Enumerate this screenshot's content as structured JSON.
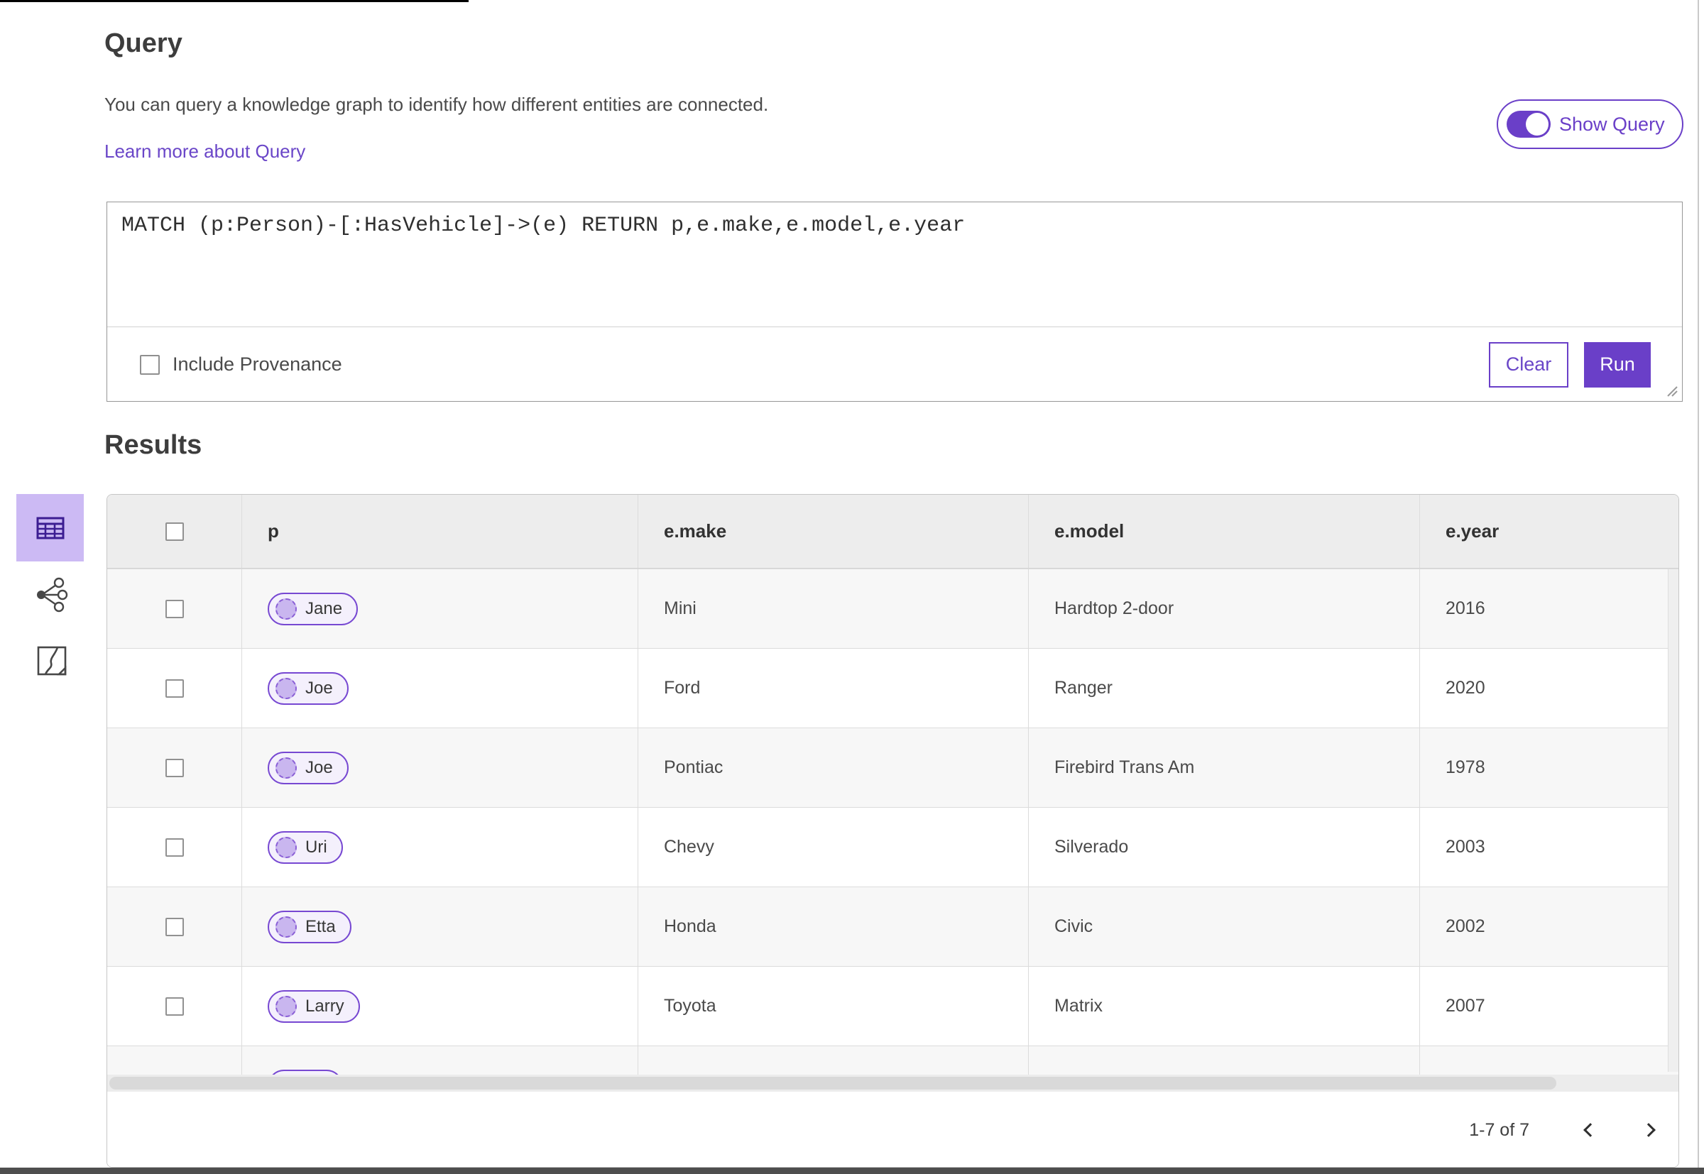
{
  "header": {
    "title": "Query",
    "description": "You can query a knowledge graph to identify how different entities are connected.",
    "learn_more_link": "Learn more about Query",
    "show_query_label": "Show Query",
    "show_query_toggle_state": "on"
  },
  "query_editor": {
    "text": "MATCH (p:Person)-[:HasVehicle]->(e) RETURN p,e.make,e.model,e.year",
    "include_provenance_label": "Include Provenance",
    "include_provenance_checked": false,
    "clear_label": "Clear",
    "run_label": "Run"
  },
  "results": {
    "heading": "Results",
    "view_switcher": [
      {
        "icon": "table-view-icon",
        "active": true
      },
      {
        "icon": "link-chart-view-icon",
        "active": false
      },
      {
        "icon": "map-view-icon",
        "active": false
      }
    ],
    "table": {
      "columns": [
        "p",
        "e.make",
        "e.model",
        "e.year"
      ],
      "rows": [
        {
          "p": "Jane",
          "make": "Mini",
          "model": "Hardtop 2-door",
          "year": "2016"
        },
        {
          "p": "Joe",
          "make": "Ford",
          "model": "Ranger",
          "year": "2020"
        },
        {
          "p": "Joe",
          "make": "Pontiac",
          "model": "Firebird Trans Am",
          "year": "1978"
        },
        {
          "p": "Uri",
          "make": "Chevy",
          "model": "Silverado",
          "year": "2003"
        },
        {
          "p": "Etta",
          "make": "Honda",
          "model": "Civic",
          "year": "2002"
        },
        {
          "p": "Larry",
          "make": "Toyota",
          "model": "Matrix",
          "year": "2007"
        },
        {
          "p": "",
          "make": "",
          "model": "",
          "year": ""
        }
      ],
      "pagination": {
        "range_label": "1-7 of 7",
        "prev_icon": "chevron-left-icon",
        "next_icon": "chevron-right-icon"
      }
    }
  },
  "colors": {
    "accent": "#6a3fc8",
    "accent_light_bg": "#ccbaf4",
    "icon_dark_purple": "#3c1d92",
    "pill_border": "#7748d2",
    "pill_fill": "#f4f0fc",
    "entity_circle_fill": "#c9b6ef",
    "header_bg": "#ededed",
    "row_alt_bg": "#f7f7f7"
  }
}
